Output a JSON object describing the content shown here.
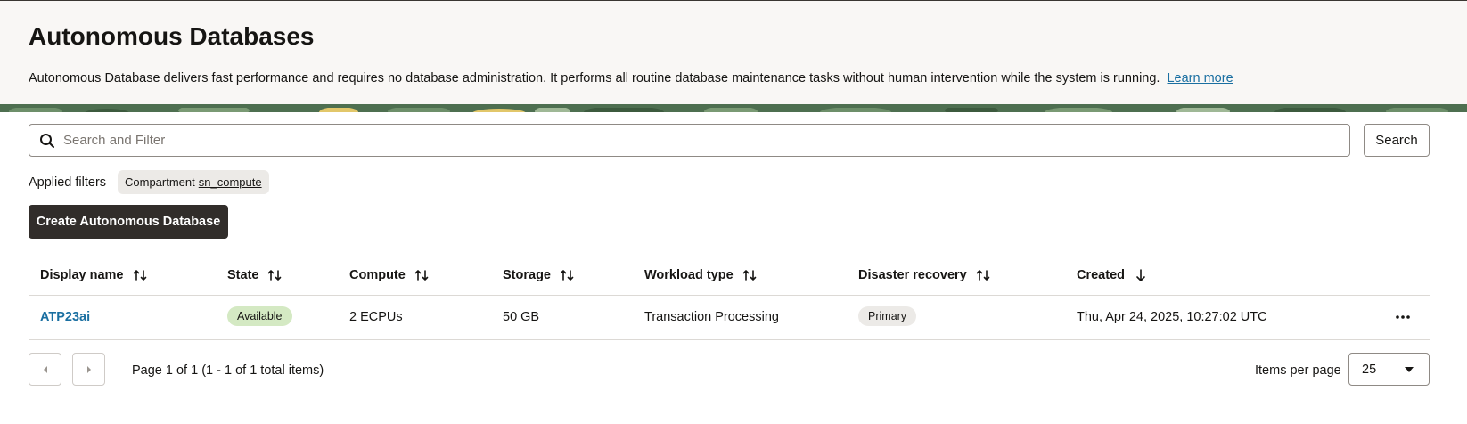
{
  "header": {
    "title": "Autonomous Databases",
    "description": "Autonomous Database delivers fast performance and requires no database administration. It performs all routine database maintenance tasks without human intervention while the system is running.",
    "learn_more": "Learn more"
  },
  "search": {
    "placeholder": "Search and Filter",
    "button_label": "Search"
  },
  "filters": {
    "label": "Applied filters",
    "chips": [
      {
        "key": "Compartment",
        "value": "sn_compute"
      }
    ]
  },
  "create_button": "Create Autonomous Database",
  "table": {
    "columns": [
      "Display name",
      "State",
      "Compute",
      "Storage",
      "Workload type",
      "Disaster recovery",
      "Created"
    ],
    "sort": {
      "Created": "descending"
    },
    "rows": [
      {
        "display_name": "ATP23ai",
        "state": "Available",
        "compute": "2 ECPUs",
        "storage": "50 GB",
        "workload_type": "Transaction Processing",
        "disaster_recovery": "Primary",
        "created": "Thu, Apr 24, 2025, 10:27:02 UTC"
      }
    ]
  },
  "pagination": {
    "info": "Page 1 of 1 (1 - 1 of 1 total items)",
    "items_per_page_label": "Items per page",
    "items_per_page": "25"
  },
  "colors": {
    "primary_button": "#312d2a",
    "link": "#1a6fa1",
    "available_badge": "#d4e9c3",
    "header_bg": "#f9f7f5"
  },
  "icons": [
    "search-icon",
    "sort-icon",
    "sort-down-icon",
    "more-icon",
    "chevron-left-icon",
    "chevron-right-icon",
    "caret-down-icon"
  ]
}
